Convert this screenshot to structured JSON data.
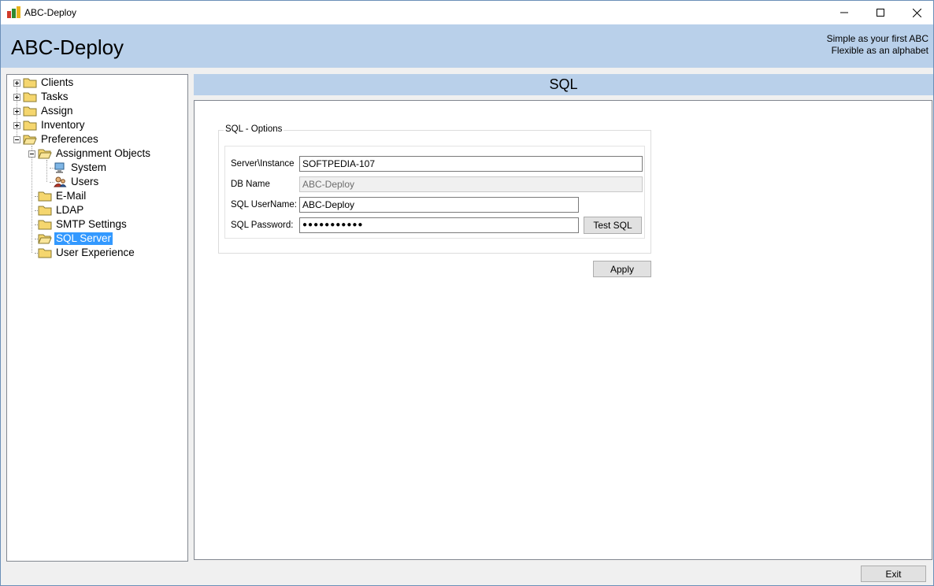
{
  "window": {
    "title": "ABC-Deploy",
    "controls": {
      "minimize": "minimize-icon",
      "maximize": "maximize-icon",
      "close": "close-icon"
    }
  },
  "banner": {
    "title": "ABC-Deploy",
    "tagline_1": "Simple as your first ABC",
    "tagline_2": "Flexible as an alphabet",
    "background": "#b9d0ea"
  },
  "tree": {
    "items": [
      {
        "label": "Clients",
        "icon": "folder-closed-icon",
        "expander": "plus"
      },
      {
        "label": "Tasks",
        "icon": "folder-closed-icon",
        "expander": "plus"
      },
      {
        "label": "Assign",
        "icon": "folder-closed-icon",
        "expander": "plus"
      },
      {
        "label": "Inventory",
        "icon": "folder-closed-icon",
        "expander": "plus"
      },
      {
        "label": "Preferences",
        "icon": "folder-open-icon",
        "expander": "minus"
      },
      {
        "label": "Assignment Objects",
        "icon": "folder-open-icon",
        "expander": "minus"
      },
      {
        "label": "System",
        "icon": "computer-icon"
      },
      {
        "label": "Users",
        "icon": "users-icon"
      },
      {
        "label": "E-Mail",
        "icon": "folder-closed-icon"
      },
      {
        "label": "LDAP",
        "icon": "folder-closed-icon"
      },
      {
        "label": "SMTP Settings",
        "icon": "folder-closed-icon"
      },
      {
        "label": "SQL Server",
        "icon": "folder-open-icon",
        "selected": true
      },
      {
        "label": "User Experience",
        "icon": "folder-closed-icon"
      }
    ],
    "selection_color": "#3399ff"
  },
  "section": {
    "title": "SQL"
  },
  "sql_options": {
    "group_label": "SQL - Options",
    "server_label": "Server\\Instance",
    "server_value": "SOFTPEDIA-107",
    "dbname_label": "DB Name",
    "dbname_value": "ABC-Deploy",
    "username_label": "SQL UserName:",
    "username_value": "ABC-Deploy",
    "password_label": "SQL Password:",
    "password_mask": "●●●●●●●●●●●",
    "test_button": "Test SQL"
  },
  "actions": {
    "apply": "Apply",
    "exit": "Exit"
  }
}
